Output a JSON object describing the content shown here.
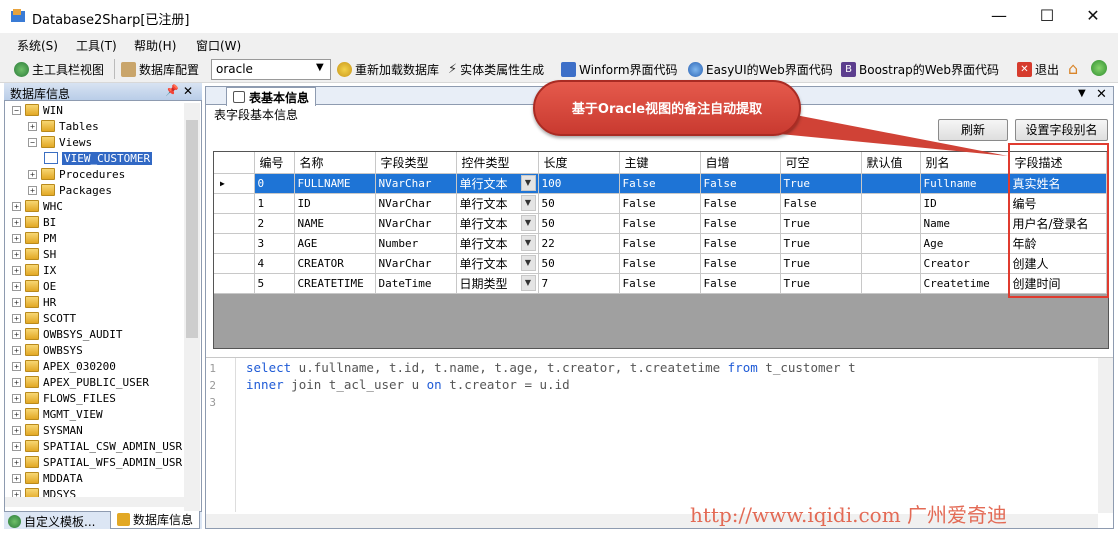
{
  "window": {
    "title": "Database2Sharp[已注册]",
    "minimize": "—",
    "maximize": "☐",
    "close": "✕"
  },
  "menu": [
    "系统(S)",
    "工具(T)",
    "帮助(H)",
    "窗口(W)"
  ],
  "toolbar": {
    "main_toolbar_view": "主工具栏视图",
    "db_config": "数据库配置",
    "db_value": "oracle",
    "reload_db": "重新加载数据库",
    "entity_gen": "实体类属性生成",
    "winform": "Winform界面代码",
    "easyui": "EasyUI的Web界面代码",
    "bootstrap": "Boostrap的Web界面代码",
    "exit": "退出"
  },
  "left_panel": {
    "title": "数据库信息",
    "tree": [
      {
        "label": "WIN",
        "level": 0,
        "expanded": true
      },
      {
        "label": "Tables",
        "level": 1,
        "expanded": false
      },
      {
        "label": "Views",
        "level": 1,
        "expanded": true
      },
      {
        "label": "VIEW_CUSTOMER",
        "level": 2,
        "selected": true
      },
      {
        "label": "Procedures",
        "level": 1
      },
      {
        "label": "Packages",
        "level": 1
      },
      {
        "label": "WHC",
        "level": 0
      },
      {
        "label": "BI",
        "level": 0
      },
      {
        "label": "PM",
        "level": 0
      },
      {
        "label": "SH",
        "level": 0
      },
      {
        "label": "IX",
        "level": 0
      },
      {
        "label": "OE",
        "level": 0
      },
      {
        "label": "HR",
        "level": 0
      },
      {
        "label": "SCOTT",
        "level": 0
      },
      {
        "label": "OWBSYS_AUDIT",
        "level": 0
      },
      {
        "label": "OWBSYS",
        "level": 0
      },
      {
        "label": "APEX_030200",
        "level": 0
      },
      {
        "label": "APEX_PUBLIC_USER",
        "level": 0
      },
      {
        "label": "FLOWS_FILES",
        "level": 0
      },
      {
        "label": "MGMT_VIEW",
        "level": 0
      },
      {
        "label": "SYSMAN",
        "level": 0
      },
      {
        "label": "SPATIAL_CSW_ADMIN_USR",
        "level": 0
      },
      {
        "label": "SPATIAL_WFS_ADMIN_USR",
        "level": 0
      },
      {
        "label": "MDDATA",
        "level": 0
      },
      {
        "label": "MDSYS",
        "level": 0
      }
    ],
    "tabs": [
      "自定义模板...",
      "数据库信息"
    ]
  },
  "doc": {
    "tab_title": "表基本信息",
    "subtitle": "表字段基本信息",
    "refresh": "刷新",
    "set_alias": "设置字段别名",
    "callout": "基于Oracle视图的备注自动提取"
  },
  "grid": {
    "columns": [
      "编号",
      "名称",
      "字段类型",
      "控件类型",
      "长度",
      "主键",
      "自增",
      "可空",
      "默认值",
      "别名",
      "字段描述"
    ],
    "rows": [
      [
        "0",
        "FULLNAME",
        "NVarChar",
        "单行文本",
        "100",
        "False",
        "False",
        "True",
        "",
        "Fullname",
        "真实姓名"
      ],
      [
        "1",
        "ID",
        "NVarChar",
        "单行文本",
        "50",
        "False",
        "False",
        "False",
        "",
        "ID",
        "编号"
      ],
      [
        "2",
        "NAME",
        "NVarChar",
        "单行文本",
        "50",
        "False",
        "False",
        "True",
        "",
        "Name",
        "用户名/登录名"
      ],
      [
        "3",
        "AGE",
        "Number",
        "单行文本",
        "22",
        "False",
        "False",
        "True",
        "",
        "Age",
        "年龄"
      ],
      [
        "4",
        "CREATOR",
        "NVarChar",
        "单行文本",
        "50",
        "False",
        "False",
        "True",
        "",
        "Creator",
        "创建人"
      ],
      [
        "5",
        "CREATETIME",
        "DateTime",
        "日期类型",
        "7",
        "False",
        "False",
        "True",
        "",
        "Createtime",
        "创建时间"
      ]
    ]
  },
  "sql": {
    "line_numbers": [
      "1",
      "2",
      "3"
    ],
    "l1_kw1": "select",
    "l1_rest": " u.fullname, t.id, t.name, t.age, t.creator, t.createtime ",
    "l1_kw2": "from",
    "l1_tail": " t_customer t",
    "l2_kw1": "inner",
    "l2_mid": " join t_acl_user u ",
    "l2_kw2": "on",
    "l2_tail": " t.creator = u.id"
  },
  "watermark": "http://www.iqidi.com 广州爱奇迪"
}
